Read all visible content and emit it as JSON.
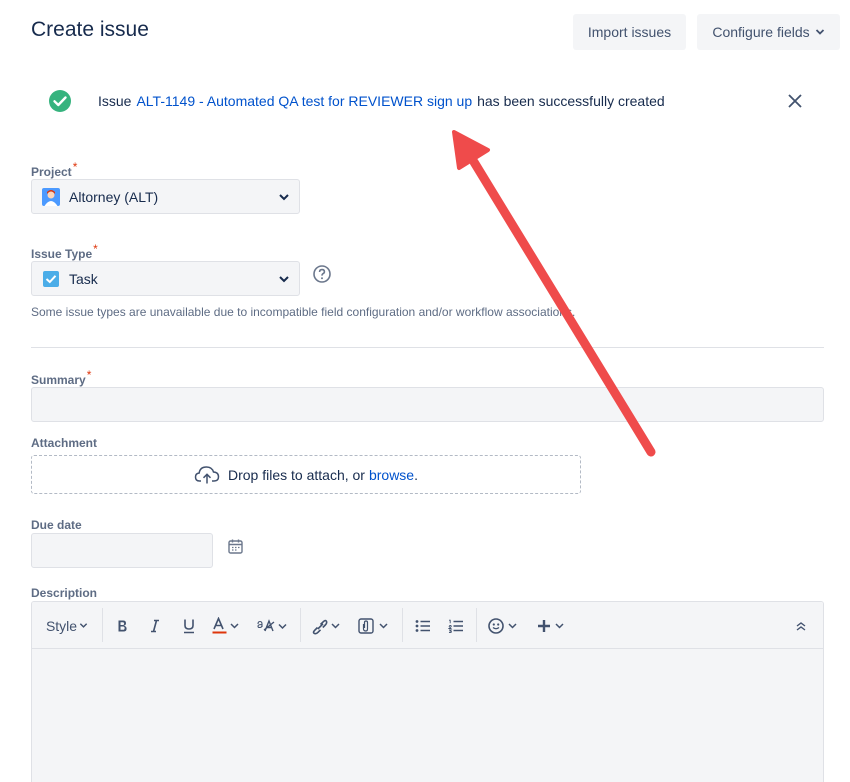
{
  "page": {
    "title": "Create issue",
    "import_button": "Import issues",
    "configure_button": "Configure fields"
  },
  "flag": {
    "prefix": "Issue",
    "issue_link": "ALT-1149 - Automated QA test for REVIEWER sign up",
    "suffix": "has been successfully created",
    "success_color": "#36b37e"
  },
  "form": {
    "project": {
      "label": "Project",
      "required": "*",
      "value": "Altorney (ALT)"
    },
    "issue_type": {
      "label": "Issue Type",
      "required": "*",
      "value": "Task",
      "hint": "Some issue types are unavailable due to incompatible field configuration and/or workflow associations."
    },
    "summary": {
      "label": "Summary",
      "required": "*",
      "value": ""
    },
    "attachment": {
      "label": "Attachment",
      "drop_text": "Drop files to attach, or",
      "browse_text": "browse",
      "period": "."
    },
    "due_date": {
      "label": "Due date",
      "value": ""
    },
    "description": {
      "label": "Description",
      "style_label": "Style"
    }
  },
  "annotation": {
    "arrow_color": "#ef4b4b"
  }
}
